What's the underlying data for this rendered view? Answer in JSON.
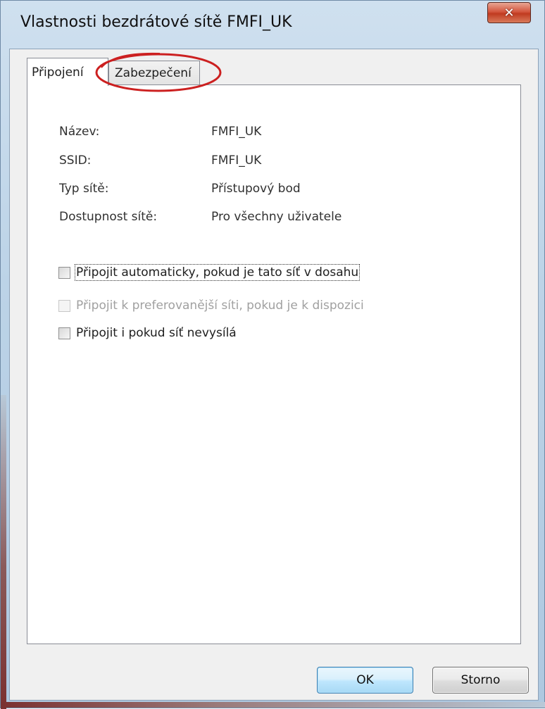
{
  "window": {
    "title": "Vlastnosti bezdrátové sítě FMFI_UK",
    "close_glyph": "✕"
  },
  "tabs": [
    {
      "label": "Připojení",
      "active": true
    },
    {
      "label": "Zabezpečení",
      "active": false
    }
  ],
  "annotation": {
    "color": "#cc2020",
    "shape": "ellipse"
  },
  "fields": [
    {
      "label": "Název:",
      "value": "FMFI_UK"
    },
    {
      "label": "SSID:",
      "value": "FMFI_UK"
    },
    {
      "label": "Typ sítě:",
      "value": "Přístupový bod"
    },
    {
      "label": "Dostupnost sítě:",
      "value": "Pro všechny uživatele"
    }
  ],
  "checkboxes": [
    {
      "label": "Připojit automaticky, pokud je tato síť v dosahu",
      "checked": false,
      "enabled": true
    },
    {
      "label": "Připojit k preferovanější síti, pokud je k dispozici",
      "checked": false,
      "enabled": false
    },
    {
      "label": "Připojit i pokud síť nevysílá",
      "checked": false,
      "enabled": true
    }
  ],
  "buttons": {
    "ok_label": "OK",
    "cancel_label": "Storno"
  },
  "colors": {
    "titlebar": "#bcd3e7",
    "close_button": "#c03a20",
    "ok_border": "#3c7fb1"
  }
}
